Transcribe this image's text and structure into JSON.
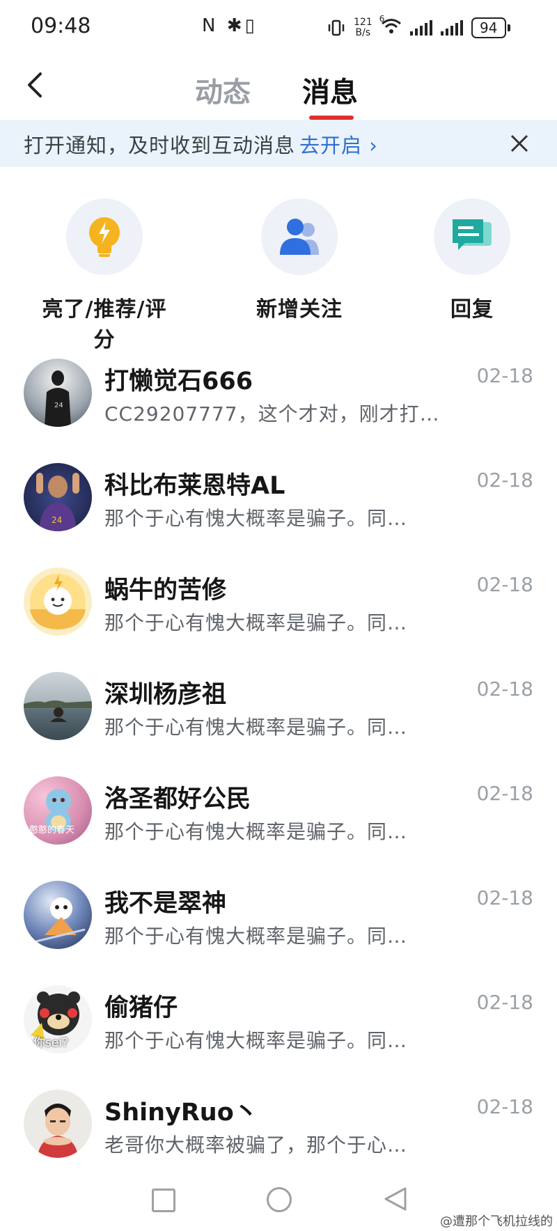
{
  "status_bar": {
    "time": "09:48",
    "mid_icons": "N ✱▯",
    "net_speed_top": "121",
    "net_speed_bottom": "B/s",
    "wifi_sup": "6",
    "battery": "94"
  },
  "header": {
    "tabs": [
      {
        "label": "动态",
        "active": false
      },
      {
        "label": "消息",
        "active": true
      }
    ],
    "accent_color": "#e12d2d"
  },
  "notice": {
    "text": "打开通知，及时收到互动消息",
    "link": "去开启 ›"
  },
  "quick_actions": [
    {
      "label": "亮了/推荐/评分",
      "icon": "lightbulb-icon"
    },
    {
      "label": "新增关注",
      "icon": "users-icon"
    },
    {
      "label": "回复",
      "icon": "chat-bubbles-icon"
    }
  ],
  "messages": [
    {
      "name": "打懒觉石666",
      "preview": "CC29207777，这个才对，刚才打…",
      "date": "02-18"
    },
    {
      "name": "科比布莱恩特AL",
      "preview": "那个于心有愧大概率是骗子。同…",
      "date": "02-18"
    },
    {
      "name": "蜗牛的苦修",
      "preview": "那个于心有愧大概率是骗子。同…",
      "date": "02-18"
    },
    {
      "name": "深圳杨彦祖",
      "preview": "那个于心有愧大概率是骗子。同…",
      "date": "02-18"
    },
    {
      "name": "洛圣都好公民",
      "preview": "那个于心有愧大概率是骗子。同…",
      "date": "02-18",
      "avatar_caption": "憨憨的春天"
    },
    {
      "name": "我不是翠神",
      "preview": "那个于心有愧大概率是骗子。同…",
      "date": "02-18"
    },
    {
      "name": "偷猪仔",
      "preview": "那个于心有愧大概率是骗子。同…",
      "date": "02-18",
      "avatar_caption": "你sei?"
    },
    {
      "name": "ShinyRuo丶",
      "preview": "老哥你大概率被骗了，那个于心…",
      "date": "02-18"
    }
  ],
  "watermark": "@遭那个飞机拉线的"
}
